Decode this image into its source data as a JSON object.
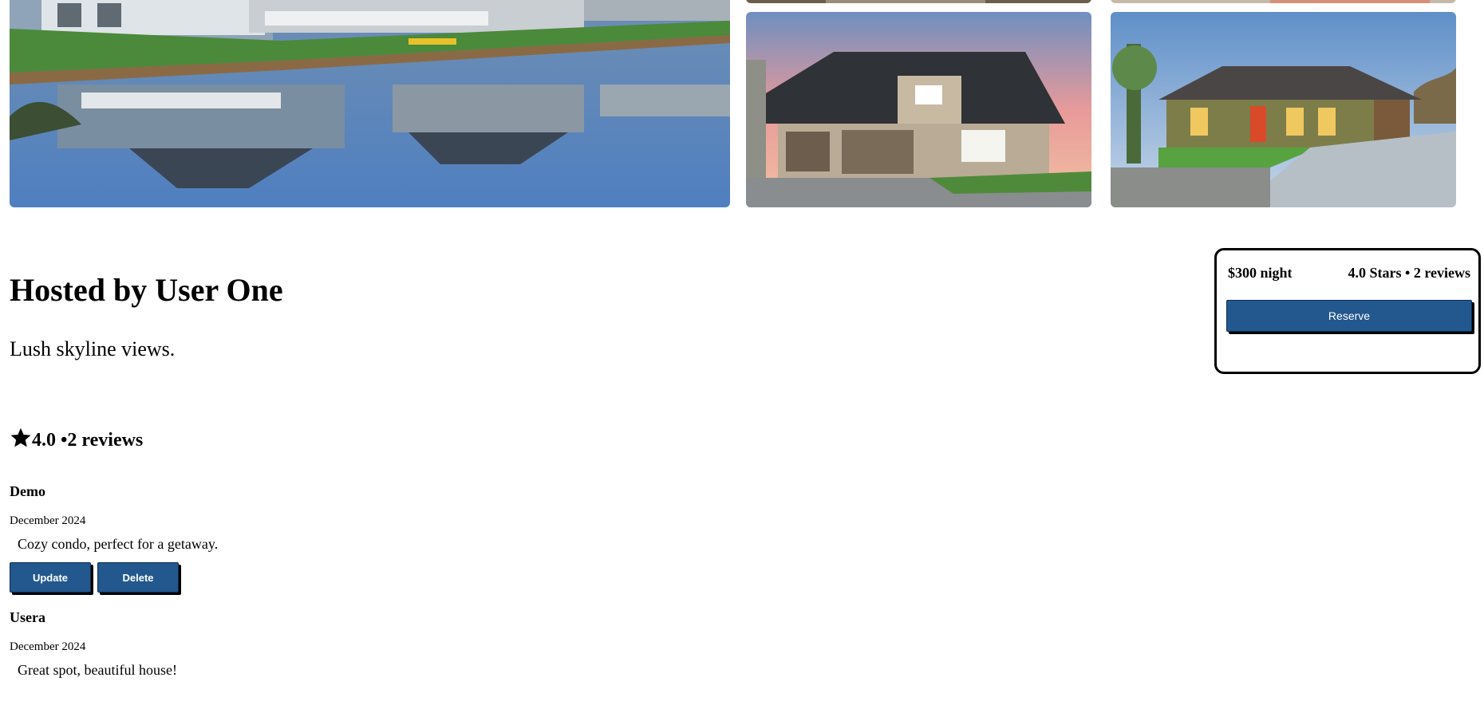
{
  "listing": {
    "host_title": "Hosted by User One",
    "description": "Lush skyline views."
  },
  "booking": {
    "price": "$300 night",
    "rating": "4.0 Stars • 2 reviews",
    "reserve_label": "Reserve"
  },
  "reviews_summary": {
    "icon": "star-icon",
    "text": "4.0 •2 reviews"
  },
  "reviews": [
    {
      "name": "Demo",
      "date": "December 2024",
      "text": "Cozy condo, perfect for a getaway.",
      "update_label": "Update",
      "delete_label": "Delete"
    },
    {
      "name": "Usera",
      "date": "December 2024",
      "text": "Great spot, beautiful house!"
    }
  ],
  "colors": {
    "button": "#23588e",
    "border": "#000000"
  }
}
